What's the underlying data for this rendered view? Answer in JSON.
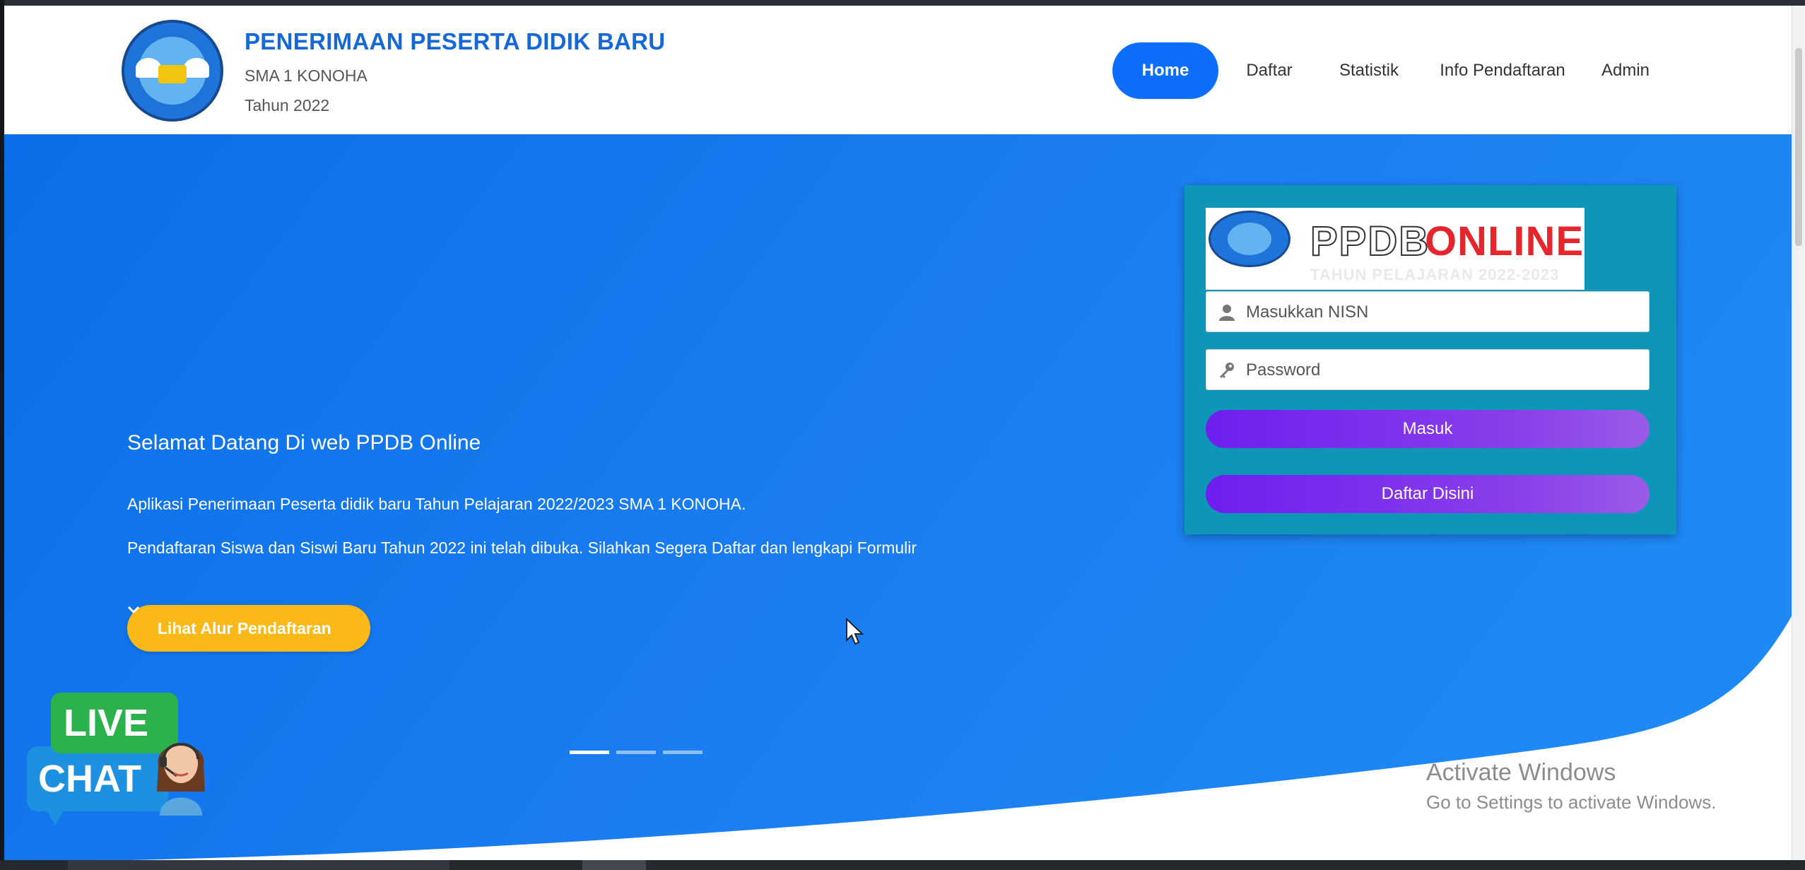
{
  "header": {
    "title": "PENERIMAAN PESERTA DIDIK BARU",
    "school": "SMA 1 KONOHA",
    "year": "Tahun 2022"
  },
  "nav": {
    "items": [
      {
        "label": "Home",
        "active": true
      },
      {
        "label": "Daftar"
      },
      {
        "label": "Statistik"
      },
      {
        "label": "Info Pendaftaran"
      },
      {
        "label": "Admin"
      }
    ]
  },
  "hero": {
    "welcome": "Selamat Datang Di web PPDB Online",
    "desc1": "Aplikasi Penerimaan Peserta didik baru Tahun Pelajaran 2022/2023 SMA 1 KONOHA.",
    "desc2": "Pendaftaran Siswa dan Siswi Baru Tahun 2022 ini telah dibuka. Silahkan Segera Daftar dan lengkapi Formulir",
    "alur_button": "Lihat Alur Pendaftaran",
    "slides": 3,
    "active_slide": 1
  },
  "login": {
    "banner_part1": "PPDB",
    "banner_part2": "ONLINE",
    "banner_sub": "TAHUN PELAJARAN 2022-2023",
    "nisn_placeholder": "Masukkan NISN",
    "password_placeholder": "Password",
    "login_button": "Masuk",
    "register_button": "Daftar Disini"
  },
  "live_chat": {
    "line1": "LIVE",
    "line2": "CHAT"
  },
  "watermark": {
    "line1": "Activate Windows",
    "line2": "Go to Settings to activate Windows."
  },
  "colors": {
    "primary": "#0d6efd",
    "hero_blue": "#1476ee",
    "accent_yellow": "#fbb917",
    "card_teal": "#0e96b8",
    "button_purple": "#6e1ff0"
  }
}
